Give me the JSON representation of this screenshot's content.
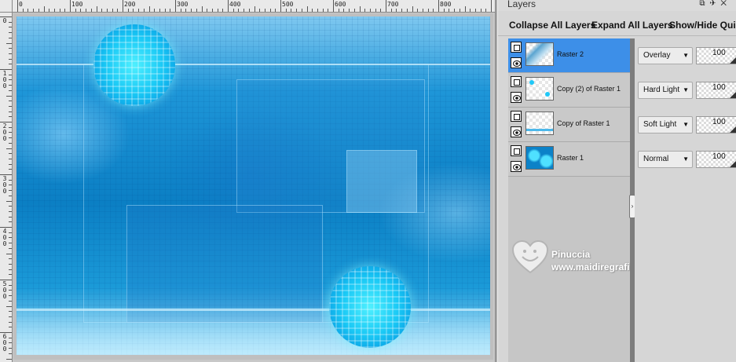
{
  "panel": {
    "title": "Layers",
    "toolbar": {
      "collapse_all": "Collapse All Layers",
      "expand_all": "Expand All Layers",
      "show_hide": "Show/Hide Quick"
    }
  },
  "rulers": {
    "horizontal_labels": [
      "0",
      "100",
      "200",
      "300",
      "400",
      "500",
      "600",
      "700",
      "800"
    ],
    "vertical_labels": [
      "0",
      "100",
      "200",
      "300",
      "400",
      "500",
      "600"
    ]
  },
  "layers": [
    {
      "name": "Raster 2",
      "blend_mode": "Overlay",
      "opacity": "100",
      "selected": true
    },
    {
      "name": "Copy (2) of Raster 1",
      "blend_mode": "Hard Light",
      "opacity": "100",
      "selected": false
    },
    {
      "name": "Copy of Raster 1",
      "blend_mode": "Soft Light",
      "opacity": "100",
      "selected": false
    },
    {
      "name": "Raster 1",
      "blend_mode": "Normal",
      "opacity": "100",
      "selected": false
    }
  ],
  "watermark": {
    "name": "Pinuccia",
    "url": "www.maidiregrafica.eu"
  },
  "colors": {
    "selected_layer": "#3d8fe8",
    "canvas_blue": "#0b7fc4",
    "blob_cyan": "#19c8f5"
  }
}
